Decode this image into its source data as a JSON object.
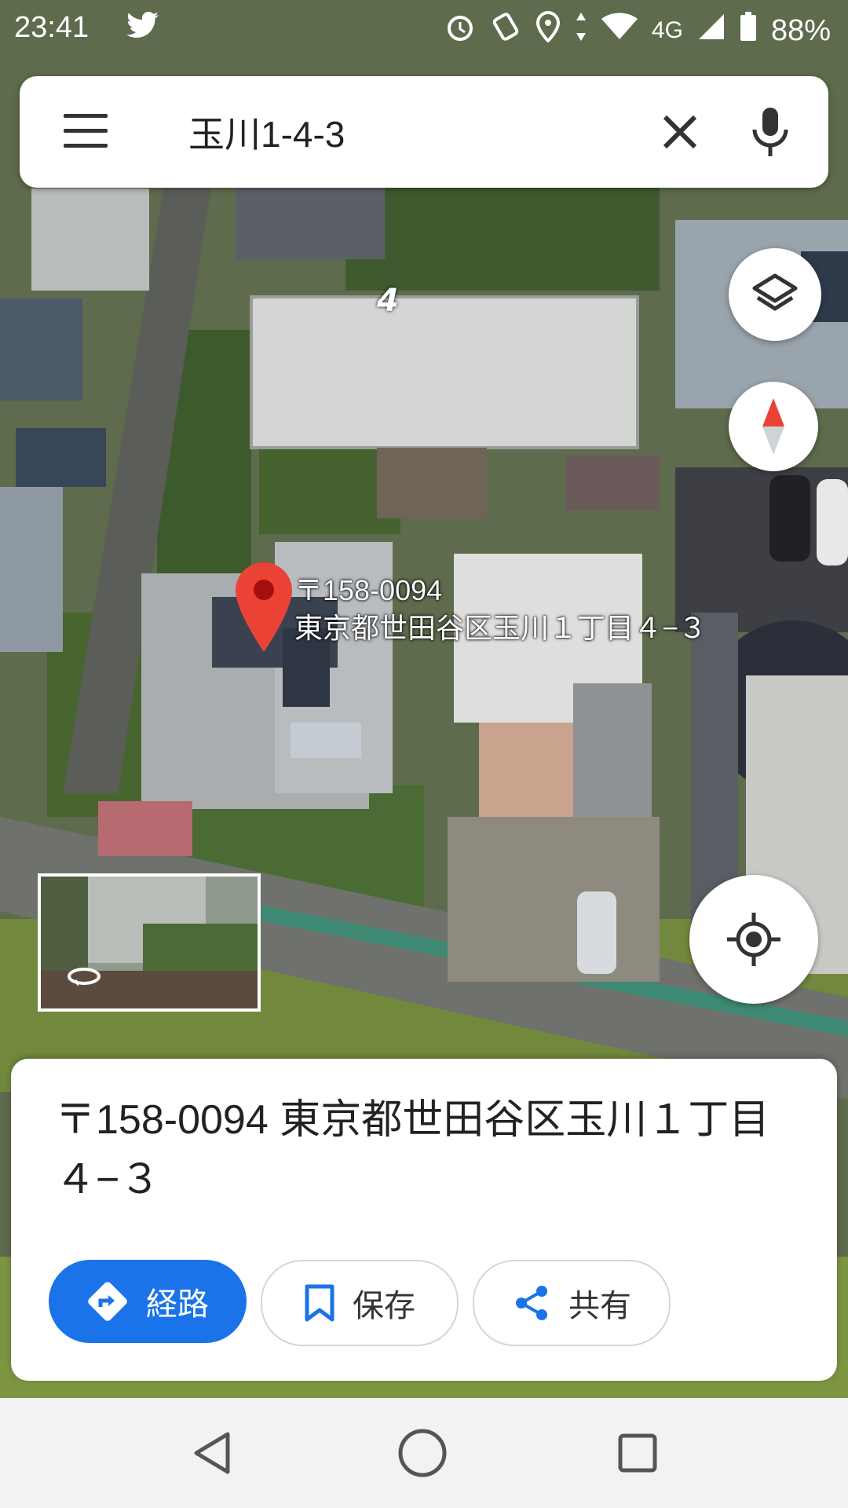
{
  "status_bar": {
    "time": "23:41",
    "network": "4G",
    "battery": "88%",
    "icons": [
      "twitter-icon",
      "alarm-icon",
      "data-saver-icon",
      "location-icon",
      "wifi-icon",
      "signal-icon",
      "battery-icon"
    ]
  },
  "search": {
    "query": "玉川1-4-3",
    "icons": [
      "menu-icon",
      "clear-icon",
      "mic-icon"
    ]
  },
  "map": {
    "pin_postal": "〒158-0094",
    "pin_address": "東京都世田谷区玉川１丁目４−３",
    "building_number": "4",
    "controls": [
      "layers-icon",
      "compass-icon",
      "my-location-icon"
    ],
    "street_view_icon": "rotate-360-icon",
    "accent_color": "#ea4335"
  },
  "place_sheet": {
    "address": "〒158-0094 東京都世田谷区玉川１丁目４−３",
    "directions_label": "経路",
    "save_label": "保存",
    "share_label": "共有",
    "primary_color": "#1a73e8"
  },
  "nav_bar": {
    "icons": [
      "back-icon",
      "home-icon",
      "recents-icon"
    ]
  }
}
